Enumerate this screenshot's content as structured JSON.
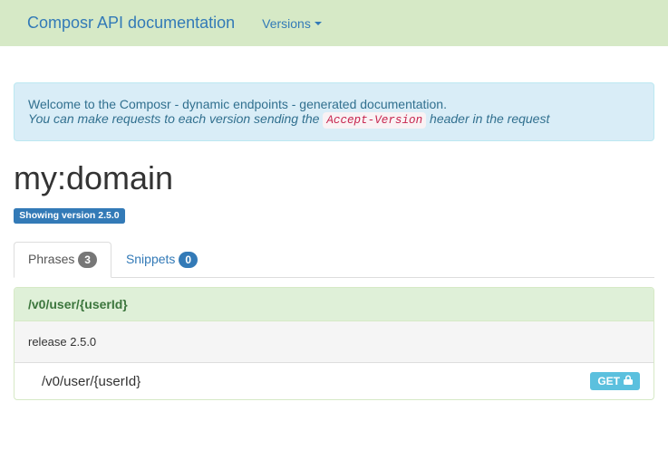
{
  "navbar": {
    "brand": "Composr API documentation",
    "versions_label": "Versions "
  },
  "alert": {
    "welcome": "Welcome to the Composr - dynamic endpoints - generated documentation.",
    "hint_prefix": "You can make requests to each version sending the ",
    "hint_code": "Accept-Version",
    "hint_suffix": " header in the request"
  },
  "domain": {
    "title": "my:domain",
    "version_label": "Showing version 2.5.0"
  },
  "tabs": {
    "phrases": {
      "label": "Phrases ",
      "count": "3"
    },
    "snippets": {
      "label": "Snippets ",
      "count": "0"
    }
  },
  "phrase_panel": {
    "heading": "/v0/user/{userId}",
    "release": "release 2.5.0",
    "methods": [
      {
        "path": "/v0/user/{userId}",
        "verb": "GET "
      }
    ]
  }
}
